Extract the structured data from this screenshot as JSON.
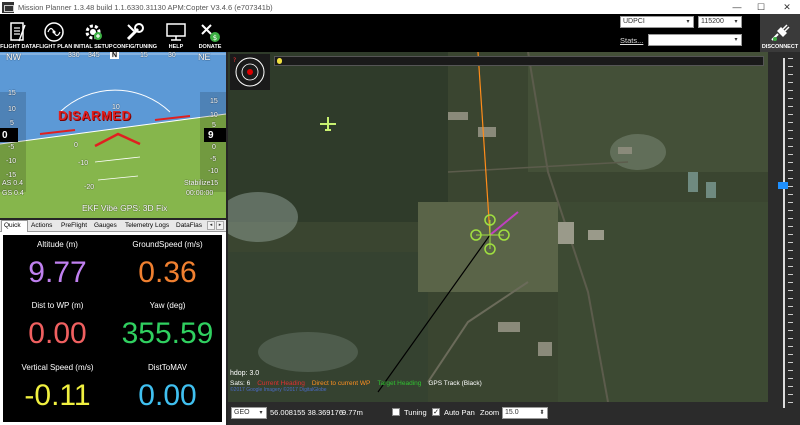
{
  "window": {
    "title": "Mission Planner 1.3.48 build 1.1.6330.31130 APM:Copter V3.4.6 (e707341b)",
    "minimize": "—",
    "maximize": "☐",
    "close": "✕"
  },
  "toolbar": {
    "buttons": [
      {
        "label": "FLIGHT DATA",
        "icon": "flight-data-icon"
      },
      {
        "label": "FLIGHT PLAN",
        "icon": "flight-plan-icon"
      },
      {
        "label": "INITIAL SETUP",
        "icon": "initial-setup-icon"
      },
      {
        "label": "CONFIG/TUNING",
        "icon": "config-tuning-icon"
      },
      {
        "label": "HELP",
        "icon": "help-icon"
      },
      {
        "label": "DONATE",
        "icon": "donate-icon"
      }
    ],
    "port": "UDPCI",
    "baud": "115200",
    "stats_label": "Stats...",
    "stats_value": "",
    "disconnect_label": "DISCONNECT"
  },
  "hud": {
    "heading_labels": [
      "NW",
      "330",
      "345",
      "N",
      "15",
      "30",
      "NE"
    ],
    "status": "DISARMED",
    "speed_ticks": [
      "15",
      "10",
      "5",
      "-5",
      "-10",
      "-15"
    ],
    "speed_value": "0",
    "alt_ticks": [
      "15",
      "10",
      "5",
      "0",
      "-5",
      "-10",
      "-15"
    ],
    "alt_value": "9",
    "pitch_labels": [
      "10",
      "0",
      "-10",
      "-20"
    ],
    "airspeed": "AS 0.4",
    "groundspeed": "GS 0.4",
    "mode": "Stabilize",
    "mode_time": "00:00:00",
    "status_line": "EKF  Vibe  GPS: 3D Fix",
    "colors": {
      "sky": "#5c99d6",
      "ground": "#86b64c",
      "warning": "#e02020"
    }
  },
  "tabs": {
    "items": [
      "Quick",
      "Actions",
      "PreFlight",
      "Gauges",
      "Telemetry Logs",
      "DataFlas"
    ],
    "active": "Quick",
    "prev": "◂",
    "next": "▸"
  },
  "quick": {
    "items": [
      {
        "label": "Altitude (m)",
        "value": "9.77",
        "color": "#c080f0"
      },
      {
        "label": "GroundSpeed (m/s)",
        "value": "0.36",
        "color": "#f08030"
      },
      {
        "label": "Dist to WP (m)",
        "value": "0.00",
        "color": "#f06060"
      },
      {
        "label": "Yaw (deg)",
        "value": "355.59",
        "color": "#30d060"
      },
      {
        "label": "Vertical Speed (m/s)",
        "value": "-0.11",
        "color": "#f0f040"
      },
      {
        "label": "DistToMAV",
        "value": "0.00",
        "color": "#40c0f0"
      }
    ]
  },
  "map": {
    "hdop": "hdop: 3.0",
    "sats": "Sats: 6",
    "legend": [
      {
        "label": "Current Heading",
        "color": "#e03030"
      },
      {
        "label": "Direct to current WP",
        "color": "#ff9020"
      },
      {
        "label": "Target Heading",
        "color": "#30c030"
      },
      {
        "label": "GPS Track (Black)",
        "color": "#ffffff"
      }
    ],
    "copyright": "©2017 Google  Imagery ©2017 DigitalGlobe"
  },
  "bottombar": {
    "coord_system": "GEO",
    "coords": "56.008155 38.369176",
    "altitude": "9.77m",
    "tuning_label": "Tuning",
    "tuning_checked": false,
    "autopan_label": "Auto Pan",
    "autopan_checked": true,
    "zoom_label": "Zoom",
    "zoom_value": "15.0"
  }
}
